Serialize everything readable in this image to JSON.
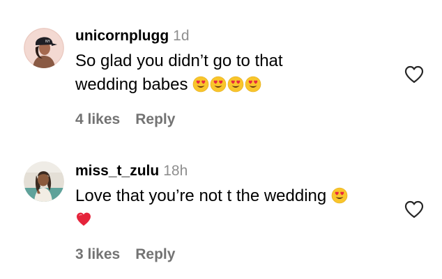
{
  "comments": [
    {
      "username": "unicornplugg",
      "time": "1d",
      "text_line1": "So glad you didn’t go to that",
      "text_line2": "wedding babes",
      "emojis": [
        "heart-eyes-emoji",
        "heart-eyes-emoji",
        "heart-eyes-emoji",
        "heart-eyes-emoji"
      ],
      "likes": "4 likes",
      "reply_label": "Reply",
      "avatar_icon": "avatar-woman-with-cap"
    },
    {
      "username": "miss_t_zulu",
      "time": "18h",
      "text_line1": "Love that you’re not t the wedding",
      "emojis": [
        "heart-eyes-emoji",
        "red-heart-emoji"
      ],
      "likes": "3 likes",
      "reply_label": "Reply",
      "avatar_icon": "avatar-woman-photo"
    }
  ],
  "colors": {
    "text": "#000000",
    "secondary": "#8e8e8e",
    "meta": "#737373",
    "heart_outline": "#262626"
  },
  "like_icon": "heart-outline-icon"
}
